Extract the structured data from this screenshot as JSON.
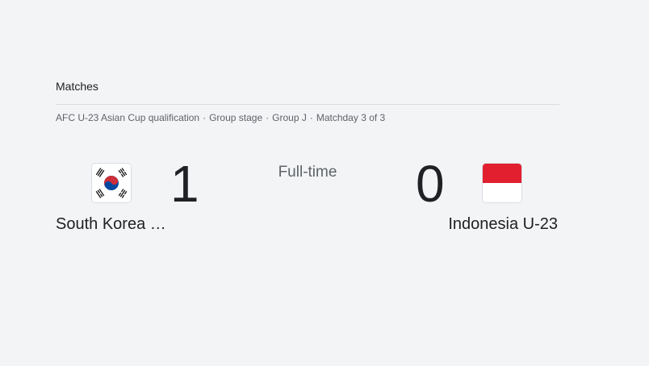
{
  "section": {
    "title": "Matches"
  },
  "match": {
    "breadcrumb": [
      "AFC U-23 Asian Cup qualification",
      "Group stage",
      "Group J",
      "Matchday 3 of 3"
    ],
    "status": "Full-time",
    "home": {
      "name": "South Korea …",
      "score": "1",
      "flag_icon": "south-korea-flag-icon"
    },
    "away": {
      "name": "Indonesia U-23",
      "score": "0",
      "flag_icon": "indonesia-flag-icon"
    }
  },
  "colors": {
    "background": "#f3f4f6",
    "text_primary": "#202124",
    "text_secondary": "#5f6368",
    "divider": "#dadce0",
    "korea_red": "#cd2e3a",
    "korea_blue": "#0047a0",
    "indonesia_red": "#e11f2f"
  }
}
